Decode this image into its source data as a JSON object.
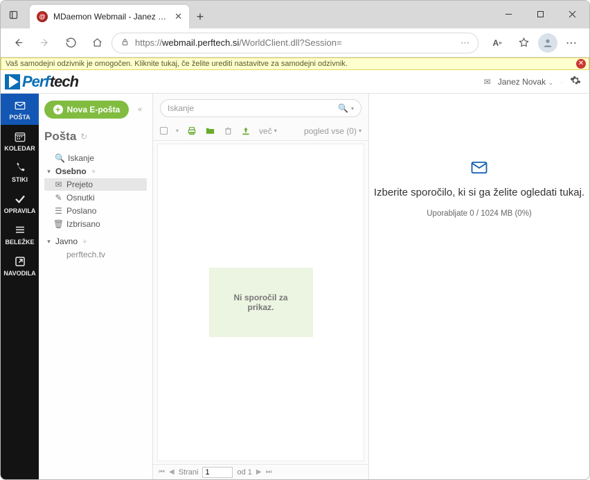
{
  "browser": {
    "tab_title": "MDaemon Webmail - Janez Nov…",
    "url_prefix": "https://",
    "url_host": "webmail.perftech.si",
    "url_path": "/WorldClient.dll?Session="
  },
  "banner": {
    "text": "Vaš samodejni odzivnik je omogočen. Kliknite tukaj, če želite urediti nastavitve za samodejni odzivnik."
  },
  "brand": {
    "part1": "Perf",
    "part2": "tech"
  },
  "user": {
    "name": "Janez Novak"
  },
  "nav": {
    "mail": "POŠTA",
    "calendar": "KOLEDAR",
    "contacts": "STIKI",
    "tasks": "OPRAVILA",
    "notes": "BELEŽKE",
    "help": "NAVODILA"
  },
  "sidebar": {
    "compose": "Nova E-pošta",
    "title": "Pošta",
    "search": "Iskanje",
    "personal": "Osebno",
    "folders": {
      "inbox": "Prejeto",
      "drafts": "Osnutki",
      "sent": "Poslano",
      "trash": "Izbrisano"
    },
    "public": "Javno",
    "public_items": {
      "tv": "perftech.tv"
    }
  },
  "list": {
    "search_placeholder": "Iskanje",
    "more": "več",
    "view_all": "pogled vse (0)",
    "empty": "Ni sporočil za prikaz.",
    "pager_pages": "Strani",
    "pager_page_value": "1",
    "pager_of": "od 1"
  },
  "reader": {
    "prompt": "Izberite sporočilo, ki si ga želite ogledati tukaj.",
    "quota": "Uporabljate 0 / 1024 MB (0%)"
  }
}
